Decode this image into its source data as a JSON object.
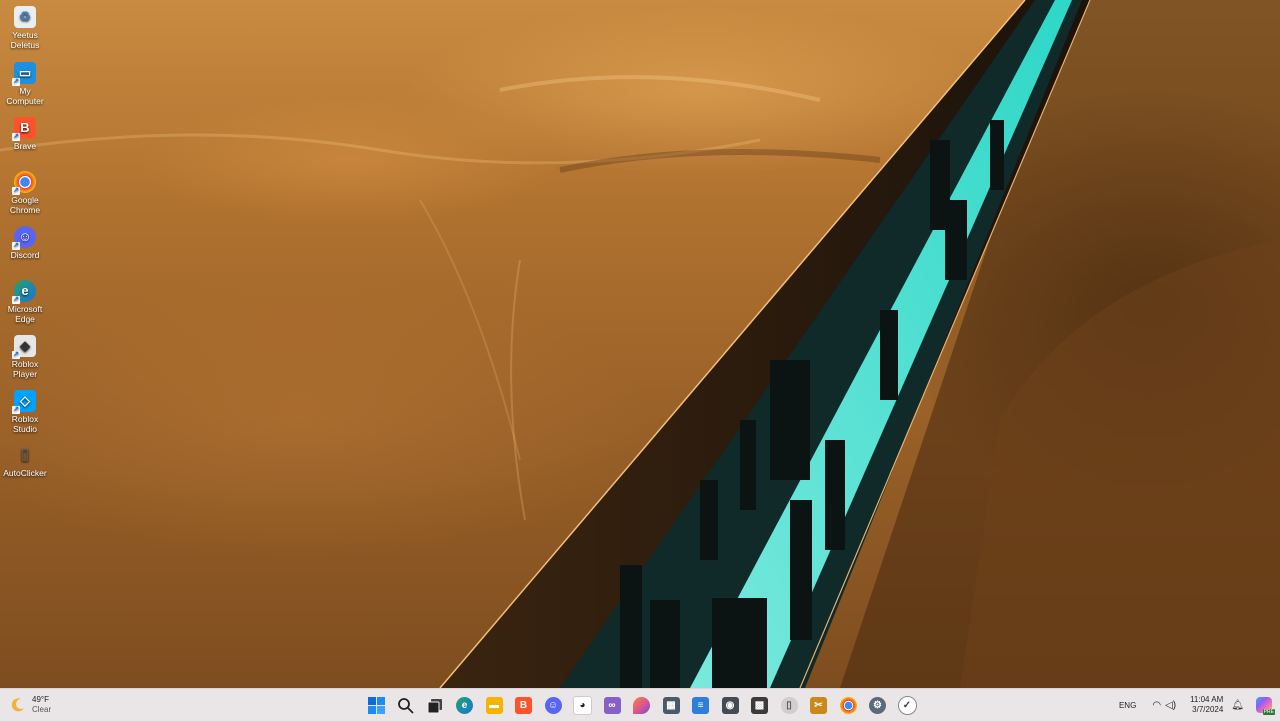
{
  "desktop": {
    "icons": [
      {
        "label": "Yeetus Deletus",
        "icon": "recycle-bin-icon",
        "color": "#e9eef3"
      },
      {
        "label": "My Computer",
        "icon": "monitor-icon",
        "color": "#1e90e0"
      },
      {
        "label": "Brave",
        "icon": "brave-lion-icon",
        "color": "#fb542b"
      },
      {
        "label": "Google Chrome",
        "icon": "chrome-icon",
        "color": "#4285f4"
      },
      {
        "label": "Discord",
        "icon": "discord-icon",
        "color": "#5865f2"
      },
      {
        "label": "Microsoft Edge",
        "icon": "edge-icon",
        "color": "#1fa36b"
      },
      {
        "label": "Roblox Player",
        "icon": "roblox-icon",
        "color": "#e6e6e6"
      },
      {
        "label": "Roblox Studio",
        "icon": "roblox-studio-icon",
        "color": "#00a2ff"
      },
      {
        "label": "AutoClicker",
        "icon": "mouse-icon",
        "color": "#6b6b6b"
      }
    ]
  },
  "taskbar": {
    "weather": {
      "temp": "49°F",
      "condition": "Clear",
      "icon": "moon-icon"
    },
    "apps": [
      {
        "name": "start-button",
        "icon": "windows-logo-icon",
        "color": "#0a6cd8"
      },
      {
        "name": "search-button",
        "icon": "search-icon",
        "color": "#222222"
      },
      {
        "name": "task-view-button",
        "icon": "task-view-icon",
        "color": "#222222"
      },
      {
        "name": "taskbar-edge",
        "icon": "edge-icon",
        "color": "#1fa36b"
      },
      {
        "name": "taskbar-file-explorer",
        "icon": "folder-icon",
        "color": "#f4b400"
      },
      {
        "name": "taskbar-brave",
        "icon": "brave-lion-icon",
        "color": "#fb542b"
      },
      {
        "name": "taskbar-discord",
        "icon": "discord-icon",
        "color": "#5865f2"
      },
      {
        "name": "taskbar-linux-app",
        "icon": "penguin-icon",
        "color": "#202020"
      },
      {
        "name": "taskbar-visual-studio",
        "icon": "visual-studio-icon",
        "color": "#8661c5"
      },
      {
        "name": "taskbar-krita",
        "icon": "paint-drop-icon",
        "color": "#e0568c"
      },
      {
        "name": "taskbar-calculator",
        "icon": "calculator-icon",
        "color": "#4a5a6a"
      },
      {
        "name": "taskbar-notepad",
        "icon": "notepad-icon",
        "color": "#2f7fd8"
      },
      {
        "name": "taskbar-camera",
        "icon": "camera-icon",
        "color": "#444b55"
      },
      {
        "name": "taskbar-minecraft",
        "icon": "creeper-icon",
        "color": "#3b3b3b"
      },
      {
        "name": "taskbar-autoclicker",
        "icon": "mouse-icon",
        "color": "#7a7a7a"
      },
      {
        "name": "taskbar-snipping-tool",
        "icon": "snip-icon",
        "color": "#c98a1b"
      },
      {
        "name": "taskbar-chrome",
        "icon": "chrome-icon",
        "color": "#4285f4"
      },
      {
        "name": "taskbar-settings",
        "icon": "gear-icon",
        "color": "#5a6b7d"
      },
      {
        "name": "taskbar-clock",
        "icon": "clock-icon",
        "color": "#3a3a3a"
      }
    ],
    "tray": {
      "language": "ENG",
      "time": "11:04 AM",
      "date": "3/7/2024"
    }
  }
}
